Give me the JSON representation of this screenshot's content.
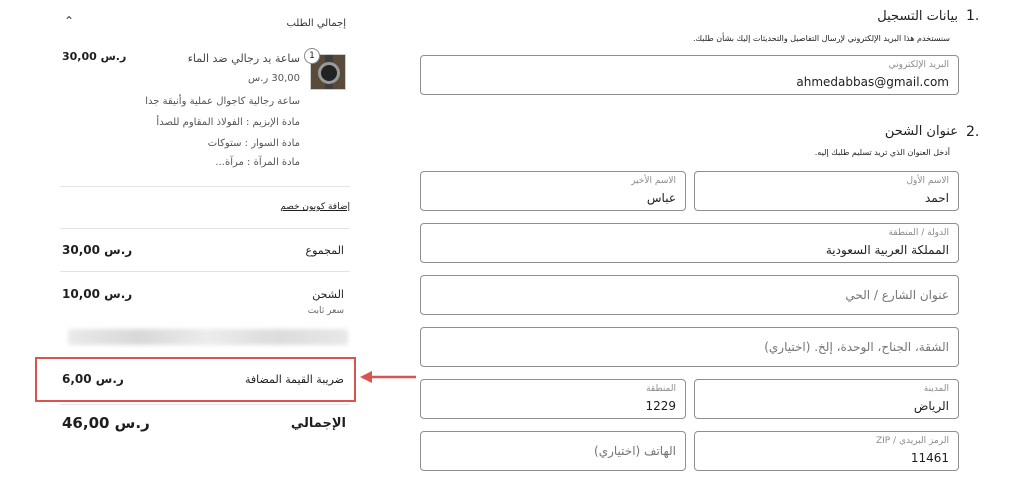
{
  "summary": {
    "title": "إجمالي الطلب",
    "item": {
      "quantity": "1",
      "name": "ساعة يد رجالي ضد الماء",
      "price": "30,00 ر.س",
      "unit_price": "30,00 ر.س",
      "description": "ساعة رجالية كاجوال عملية وأنيقة جدا",
      "attr_buckle": "مادة الإبزيم : الفولاذ المقاوم للصدأ",
      "attr_strap": "مادة السوار : ستوكات",
      "attr_mirror": "مادة المرآة : مرآة..."
    },
    "coupon_label": "إضافة كوبون خصم",
    "subtotal_label": "المجموع",
    "subtotal_value": "30,00 ر.س",
    "shipping_label": "الشحن",
    "shipping_value": "10,00 ر.س",
    "shipping_method": "سعر ثابت",
    "vat_label": "ضريبة القيمة المضافة",
    "vat_value": "6,00 ر.س",
    "total_label": "الإجمالي",
    "total_value": "46,00 ر.س"
  },
  "form": {
    "contact": {
      "number": "1.",
      "title": "بيانات التسجيل",
      "description": "سنستخدم هذا البريد الإلكتروني لإرسال التفاصيل والتحديثات إليك بشأن طلبك.",
      "email_label": "البريد الإلكتروني",
      "email_value": "ahmedabbas@gmail.com"
    },
    "shipping": {
      "number": "2.",
      "title": "عنوان الشحن",
      "description": "أدخل العنوان الذي تريد تسليم طلبك إليه.",
      "first_name_label": "الاسم الأول",
      "first_name_value": "احمد",
      "last_name_label": "الاسم الأخير",
      "last_name_value": "عباس",
      "country_label": "الدولة / المنطقة",
      "country_value": "المملكة العربية السعودية",
      "street_placeholder": "عنوان الشارع / الحي",
      "apartment_placeholder": "الشقة، الجناح، الوحدة، إلخ. (اختياري)",
      "city_label": "المدينة",
      "city_value": "الرياض",
      "region_label": "المنطقة",
      "region_value": "1229",
      "zip_label": "الرمز البريدي / ZIP",
      "zip_value": "11461",
      "phone_placeholder": "الهاتف (اختياري)"
    }
  },
  "colors": {
    "highlight": "#d9534f",
    "field_border": "#8f8f8f"
  }
}
